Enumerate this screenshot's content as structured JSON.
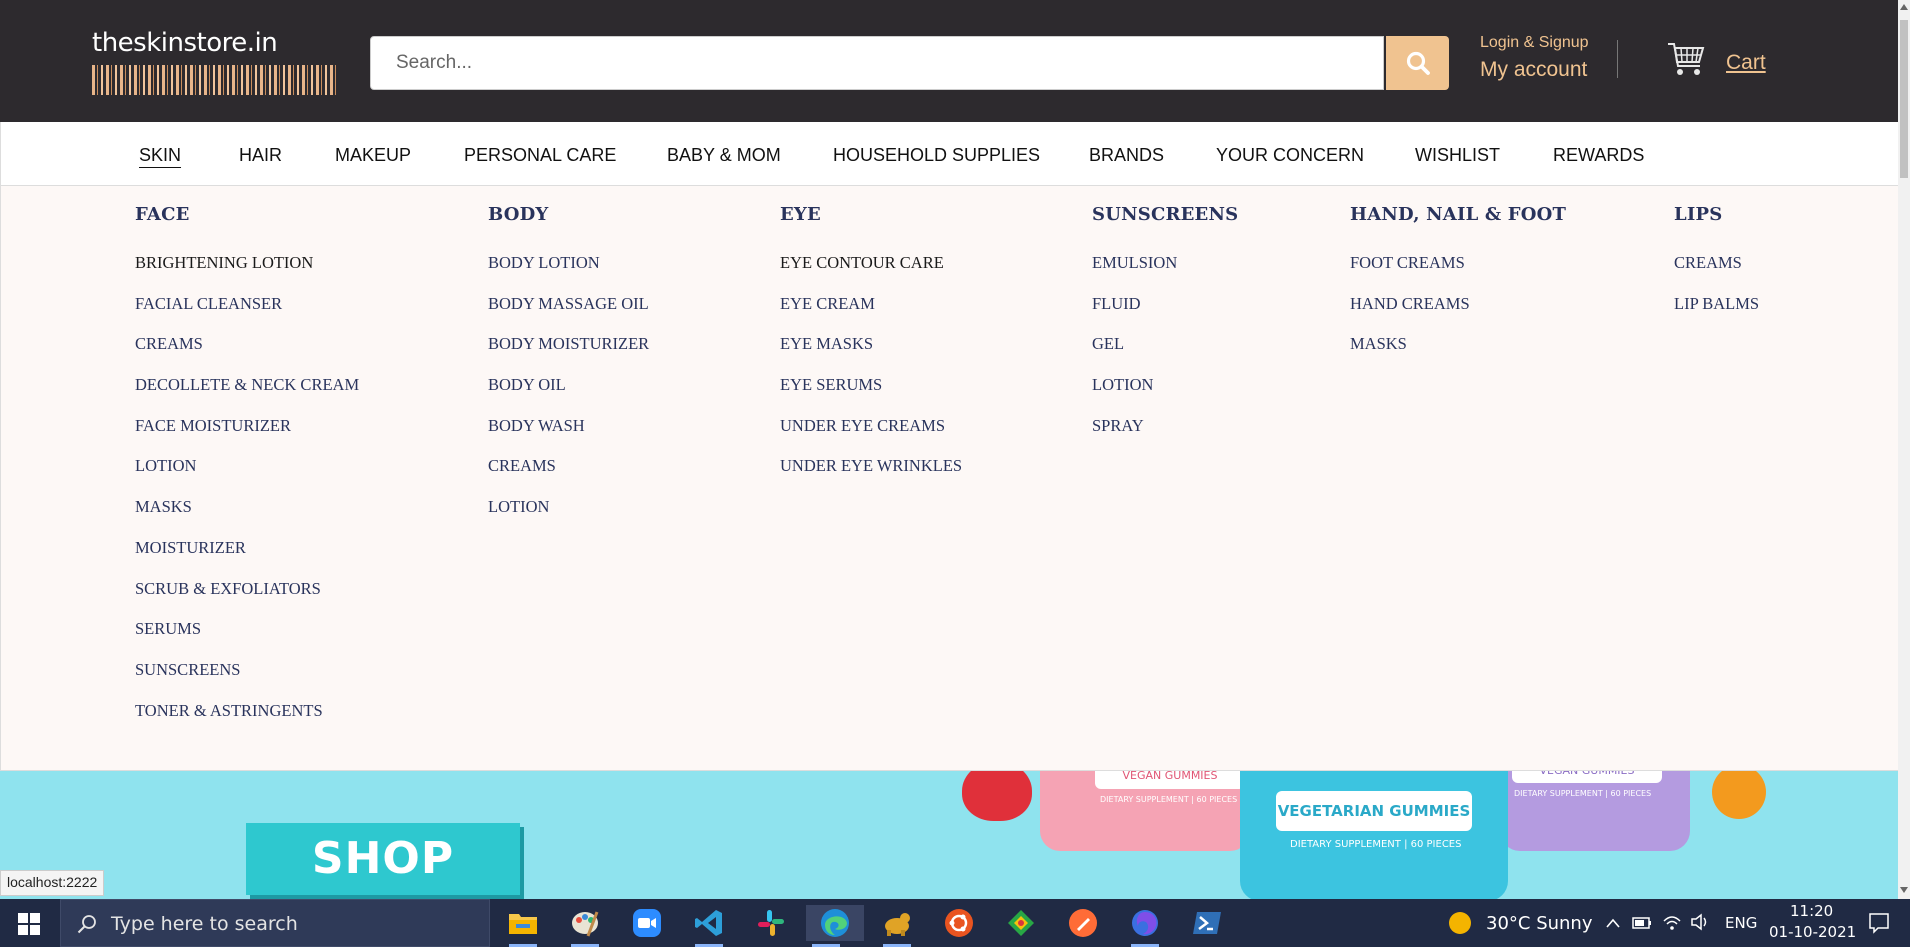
{
  "header": {
    "logo_text": "theskinstore.in",
    "search_placeholder": "Search...",
    "login_label": "Login & Signup",
    "account_label": "My account",
    "cart_label": "Cart"
  },
  "nav": {
    "items": [
      {
        "label": "SKIN",
        "active": true
      },
      {
        "label": "HAIR"
      },
      {
        "label": "MAKEUP"
      },
      {
        "label": "PERSONAL CARE"
      },
      {
        "label": "BABY & MOM"
      },
      {
        "label": "HOUSEHOLD SUPPLIES"
      },
      {
        "label": "BRANDS"
      },
      {
        "label": "YOUR CONCERN"
      },
      {
        "label": "WISHLIST"
      },
      {
        "label": "REWARDS"
      }
    ]
  },
  "mega_menu": {
    "columns": [
      {
        "title": "FACE",
        "items": [
          "BRIGHTENING LOTION",
          "FACIAL CLEANSER",
          "CREAMS",
          "DECOLLETE & NECK CREAM",
          "FACE MOISTURIZER",
          "LOTION",
          "MASKS",
          "MOISTURIZER",
          "SCRUB & EXFOLIATORS",
          "SERUMS",
          "SUNSCREENS",
          "TONER & ASTRINGENTS"
        ]
      },
      {
        "title": "BODY",
        "items": [
          "BODY LOTION",
          "BODY MASSAGE OIL",
          "BODY MOISTURIZER",
          "BODY OIL",
          "BODY WASH",
          "CREAMS",
          "LOTION"
        ]
      },
      {
        "title": "EYE",
        "items": [
          "EYE CONTOUR CARE",
          "EYE CREAM",
          "EYE MASKS",
          "EYE SERUMS",
          "UNDER EYE CREAMS",
          "UNDER EYE WRINKLES"
        ]
      },
      {
        "title": "SUNSCREENS",
        "items": [
          "EMULSION",
          "FLUID",
          "GEL",
          "LOTION",
          "SPRAY"
        ]
      },
      {
        "title": "HAND, NAIL & FOOT",
        "items": [
          "FOOT CREAMS",
          "HAND CREAMS",
          "MASKS"
        ]
      },
      {
        "title": "LIPS",
        "items": [
          "CREAMS",
          "LIP BALMS"
        ]
      }
    ]
  },
  "banner": {
    "shop_now": "SHOP NOW",
    "jar_left_label": "VEGAN GUMMIES",
    "jar_left_sub": "DIETARY SUPPLEMENT | 60 PIECES",
    "jar_center_label": "VEGETARIAN GUMMIES",
    "jar_center_sub": "DIETARY SUPPLEMENT | 60 PIECES",
    "jar_right_label": "VEGAN GUMMIES",
    "jar_right_sub": "DIETARY SUPPLEMENT | 60 PIECES"
  },
  "status_bar": {
    "url": "localhost:2222"
  },
  "taskbar": {
    "search_placeholder": "Type here to search",
    "weather": "30°C  Sunny",
    "language": "ENG",
    "time": "11:20",
    "date": "01-10-2021",
    "apps": [
      "file-explorer",
      "paint",
      "zoom",
      "vscode",
      "slack",
      "edge",
      "dbeaver",
      "ubuntu",
      "git-kraken",
      "postman",
      "firefox",
      "powershell"
    ]
  },
  "colors": {
    "header_bg": "#2d2a2e",
    "accent": "#f0c390",
    "menu_bg": "#fdf8f6",
    "menu_text": "#29335c",
    "banner_bg": "#8fe3ee"
  }
}
